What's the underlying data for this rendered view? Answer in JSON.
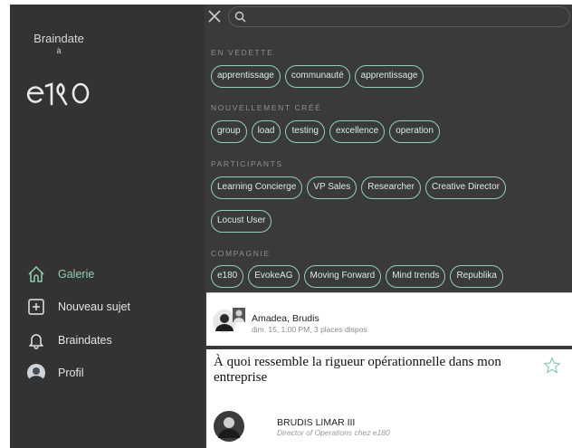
{
  "sidebar": {
    "brand_top": "Braindate",
    "brand_a": "à",
    "logo_text": "e180",
    "nav": [
      {
        "label": "Galerie",
        "icon": "home-icon"
      },
      {
        "label": "Nouveau sujet",
        "icon": "plus-square-icon"
      },
      {
        "label": "Braindates",
        "icon": "bell-icon"
      },
      {
        "label": "Profil",
        "icon": "avatar"
      }
    ]
  },
  "search": {
    "placeholder": "",
    "value": ""
  },
  "sections": [
    {
      "title": "EN VEDETTE",
      "tags": [
        "apprentissage",
        "communauté",
        "apprentissage"
      ]
    },
    {
      "title": "NOUVELLEMENT CRÉÉ",
      "tags": [
        "group",
        "load",
        "testing",
        "excellence",
        "operation"
      ]
    },
    {
      "title": "PARTICIPANTS",
      "tags": [
        "Learning Concierge",
        "VP Sales",
        "Researcher",
        "Creative Director",
        "Locust User"
      ]
    },
    {
      "title": "COMPAGNIE",
      "tags": [
        "e180",
        "EvokeAG",
        "Moving Forward",
        "Mind trends",
        "Republika"
      ]
    }
  ],
  "session_card": {
    "names": "Amadea, Brudis",
    "meta": "dim. 15, 1:00 PM, 3 places dispos"
  },
  "topic_card": {
    "title": "À quoi ressemble la rigueur opérationnelle dans mon entreprise",
    "host_name": "BRUDIS LIMAR III",
    "host_role": "Director of Operations chez e180"
  },
  "colors": {
    "accent": "#8fd1b0",
    "panel": "#3a3a3a",
    "sidebar": "#333333"
  }
}
